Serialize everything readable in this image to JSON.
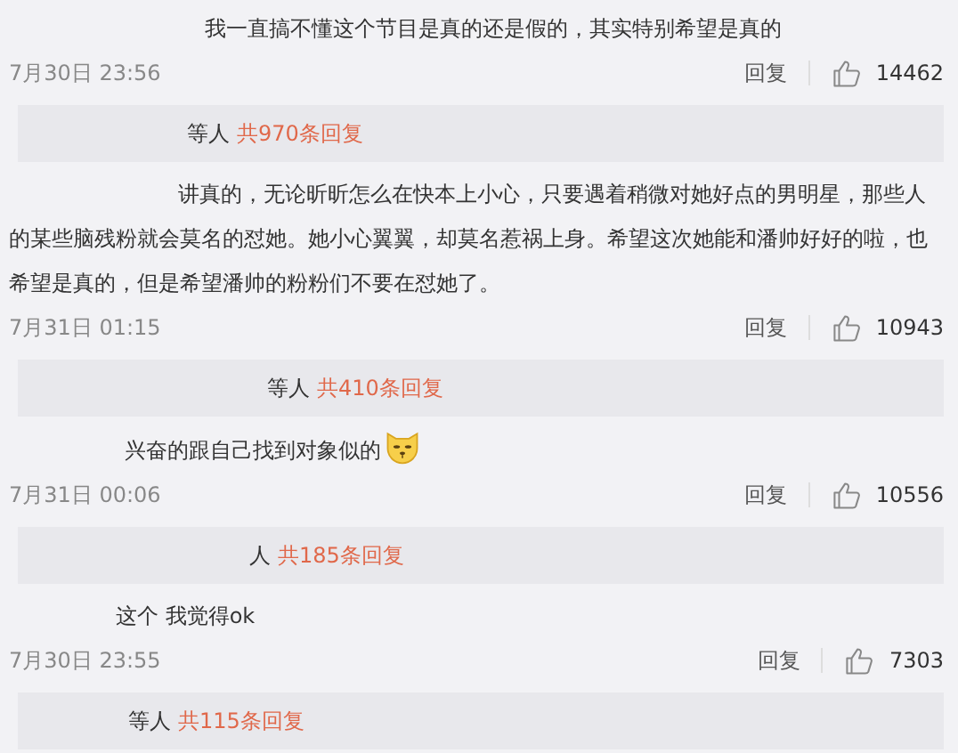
{
  "comments": [
    {
      "text": "我一直搞不懂这个节目是真的还是假的，其实特别希望是真的",
      "emoji": false,
      "time": "7月30日 23:56",
      "reply": "回复",
      "likes": "14462",
      "summary": {
        "people": "等人",
        "count": "共970条回复"
      }
    },
    {
      "text": "讲真的，无论昕昕怎么在快本上小心，只要遇着稍微对她好点的男明星，那些人的某些脑残粉就会莫名的怼她。她小心翼翼，却莫名惹祸上身。希望这次她能和潘帅好好的啦，也希望是真的，但是希望潘帅的粉粉们不要在怼她了。",
      "emoji": false,
      "time": "7月31日 01:15",
      "reply": "回复",
      "likes": "10943",
      "summary": {
        "people": "等人",
        "count": "共410条回复"
      }
    },
    {
      "text": "兴奋的跟自己找到对象似的",
      "emoji": true,
      "time": "7月31日 00:06",
      "reply": "回复",
      "likes": "10556",
      "summary": {
        "people": "人",
        "count": "共185条回复"
      }
    },
    {
      "text": "这个 我觉得ok",
      "emoji": false,
      "time": "7月30日 23:55",
      "reply": "回复",
      "likes": "7303",
      "summary": {
        "people": "等人",
        "count": "共115条回复"
      }
    }
  ]
}
